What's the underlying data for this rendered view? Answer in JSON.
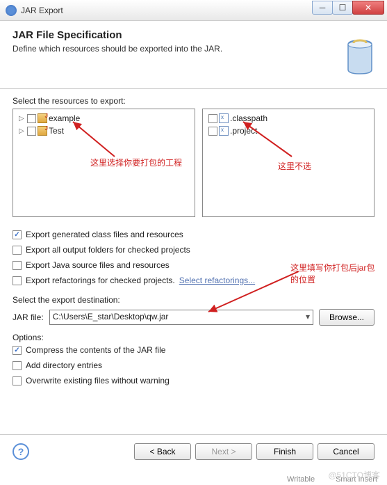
{
  "titlebar": {
    "title": "JAR Export"
  },
  "header": {
    "title": "JAR File Specification",
    "desc": "Define which resources should be exported into the JAR."
  },
  "labels": {
    "select_resources": "Select the resources to export:",
    "select_dest": "Select the export destination:",
    "jar_file": "JAR file:",
    "options": "Options:",
    "browse": "Browse...",
    "select_refactorings": "Select refactorings..."
  },
  "tree_left": [
    {
      "label": "example",
      "checked": false
    },
    {
      "label": "Test",
      "checked": false
    }
  ],
  "tree_right": [
    {
      "label": ".classpath",
      "checked": false
    },
    {
      "label": ".project",
      "checked": false
    }
  ],
  "export_opts": [
    {
      "label": "Export generated class files and resources",
      "checked": true
    },
    {
      "label": "Export all output folders for checked projects",
      "checked": false
    },
    {
      "label": "Export Java source files and resources",
      "checked": false
    },
    {
      "label": "Export refactorings for checked projects.",
      "checked": false,
      "has_link": true
    }
  ],
  "dest_path": "C:\\Users\\E_star\\Desktop\\qw.jar",
  "compress_opts": [
    {
      "label": "Compress the contents of the JAR file",
      "checked": true
    },
    {
      "label": "Add directory entries",
      "checked": false
    },
    {
      "label": "Overwrite existing files without warning",
      "checked": false
    }
  ],
  "footer": {
    "back": "< Back",
    "next": "Next >",
    "finish": "Finish",
    "cancel": "Cancel"
  },
  "annotations": {
    "left": "这里选择你要打包的工程",
    "right": "这里不选",
    "dest": "这里填写你打包后jar包的位置"
  },
  "status": {
    "writable": "Writable",
    "insert": "Smart Insert"
  },
  "watermark": "@51CTO博客"
}
